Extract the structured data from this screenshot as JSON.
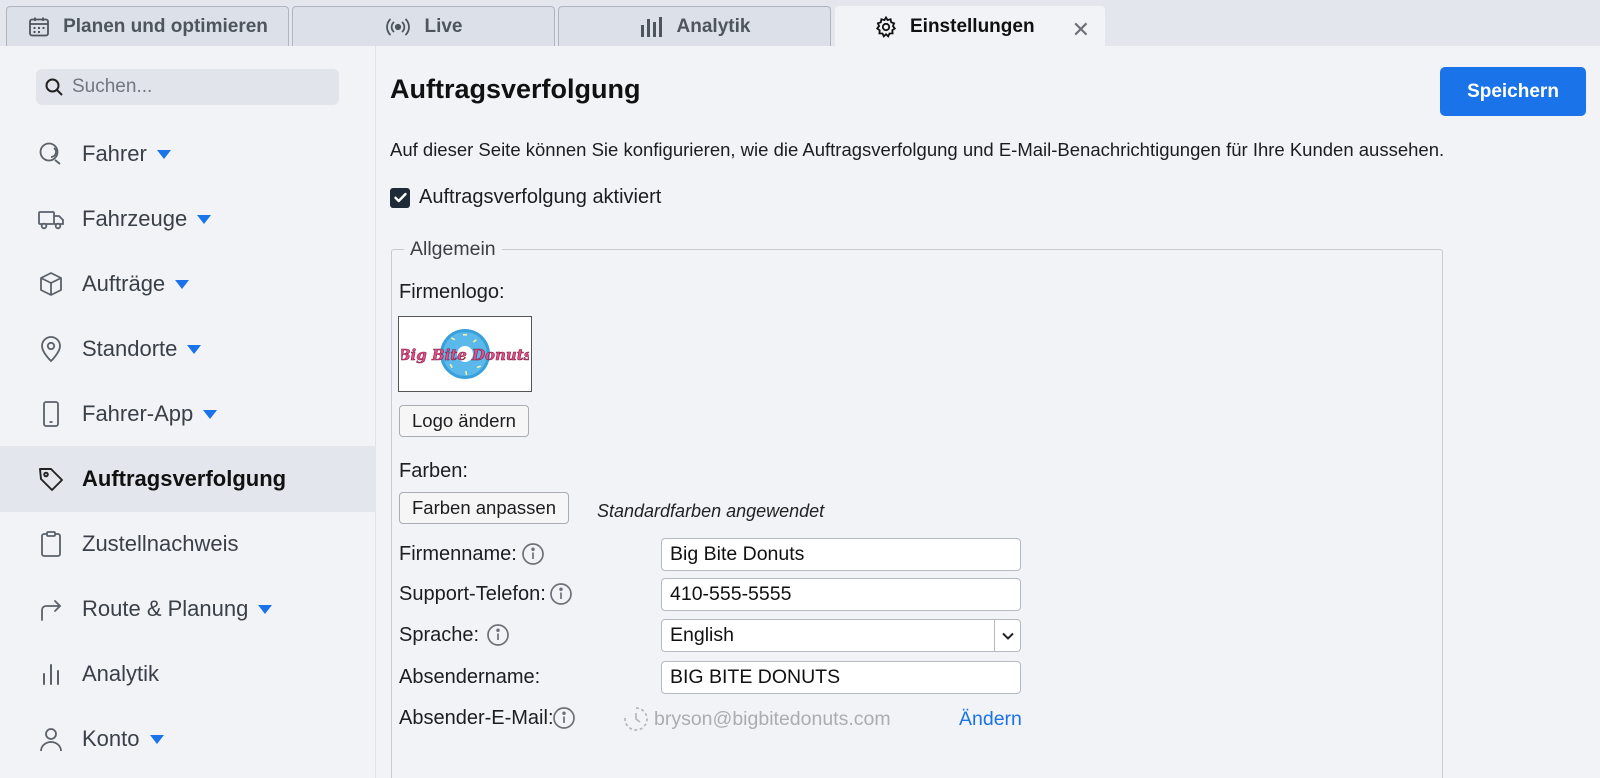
{
  "tabs": [
    {
      "label": "Planen und optimieren",
      "icon": "calendar-icon"
    },
    {
      "label": "Live",
      "icon": "broadcast-icon"
    },
    {
      "label": "Analytik",
      "icon": "bar-chart-icon"
    },
    {
      "label": "Einstellungen",
      "icon": "gear-icon",
      "active": true
    }
  ],
  "sidebar": {
    "search_placeholder": "Suchen...",
    "items": [
      {
        "label": "Fahrer",
        "icon": "driver-icon",
        "has_caret": true
      },
      {
        "label": "Fahrzeuge",
        "icon": "truck-icon",
        "has_caret": true
      },
      {
        "label": "Aufträge",
        "icon": "package-icon",
        "has_caret": true
      },
      {
        "label": "Standorte",
        "icon": "location-pin-icon",
        "has_caret": true
      },
      {
        "label": "Fahrer-App",
        "icon": "phone-icon",
        "has_caret": true
      },
      {
        "label": "Auftragsverfolgung",
        "icon": "tag-icon",
        "active": true
      },
      {
        "label": "Zustellnachweis",
        "icon": "clipboard-icon"
      },
      {
        "label": "Route & Planung",
        "icon": "route-arrow-icon",
        "has_caret": true
      },
      {
        "label": "Analytik",
        "icon": "bar-chart-icon"
      },
      {
        "label": "Konto",
        "icon": "user-icon",
        "has_caret": true
      }
    ]
  },
  "main": {
    "title": "Auftragsverfolgung",
    "save_label": "Speichern",
    "description": "Auf dieser Seite können Sie konfigurieren, wie die Auftragsverfolgung und E-Mail-Benachrichtigungen für Ihre Kunden aussehen.",
    "tracking_enabled_label": "Auftragsverfolgung aktiviert",
    "tracking_enabled": true,
    "general": {
      "legend": "Allgemein",
      "logo_label": "Firmenlogo:",
      "logo_text": "Big Bite Donuts",
      "change_logo_label": "Logo ändern",
      "colors_label": "Farben:",
      "customize_colors_label": "Farben anpassen",
      "colors_status": "Standardfarben angewendet",
      "company_name_label": "Firmenname:",
      "company_name_value": "Big Bite Donuts",
      "support_phone_label": "Support-Telefon:",
      "support_phone_value": "410-555-5555",
      "language_label": "Sprache:",
      "language_value": "English",
      "sender_name_label": "Absendername:",
      "sender_name_value": "BIG BITE DONUTS",
      "sender_email_label": "Absender-E-Mail:",
      "sender_email_value": "bryson@bigbitedonuts.com",
      "change_email_label": "Ändern"
    }
  },
  "colors": {
    "accent": "#1a73e8",
    "sidebar_active_bg": "#e3e6ec",
    "page_bg": "#f2f3f6"
  }
}
